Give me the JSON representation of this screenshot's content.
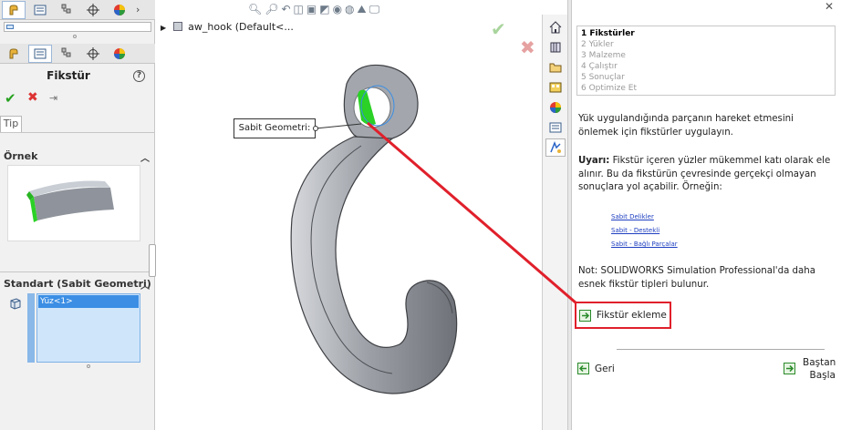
{
  "tree": {
    "node_label": "aw_hook  (Default<..."
  },
  "property_manager": {
    "title": "Fikstür",
    "tip_tab": "Tip",
    "example_header": "Örnek",
    "standard_header": "Standart (Sabit Geometri)",
    "selected_item": "Yüz<1>"
  },
  "callout": {
    "label": "Sabit Geometri:"
  },
  "wizard": {
    "steps": [
      {
        "label": "1 Fikstürler",
        "current": true
      },
      {
        "label": "2 Yükler",
        "current": false
      },
      {
        "label": "3 Malzeme",
        "current": false
      },
      {
        "label": "4 Çalıştır",
        "current": false
      },
      {
        "label": "5 Sonuçlar",
        "current": false
      },
      {
        "label": "6 Optimize Et",
        "current": false
      }
    ],
    "para1": "Yük uygulandığında parçanın hareket etmesini önlemek için fikstürler uygulayın.",
    "warning_label": "Uyarı:",
    "warning_text": " Fikstür içeren yüzler mükemmel katı olarak ele alınır. Bu da fikstürün çevresinde gerçekçi olmayan sonuçlara yol açabilir. Örneğin:",
    "links": [
      "Sabit Delikler",
      "Sabit - Destekli",
      "Sabit - Bağlı Parçalar"
    ],
    "note": "Not: SOLIDWORKS Simulation Professional'da daha esnek fikstür tipleri bulunur.",
    "add_fixture": "Fikstür ekleme",
    "back": "Geri",
    "restart_line1": "Baştan",
    "restart_line2": "Başla"
  },
  "colors": {
    "accent_red": "#e0202b",
    "selection_blue": "#3b8ee4",
    "face_green": "#2bd126",
    "ok_green": "#26a11f"
  }
}
